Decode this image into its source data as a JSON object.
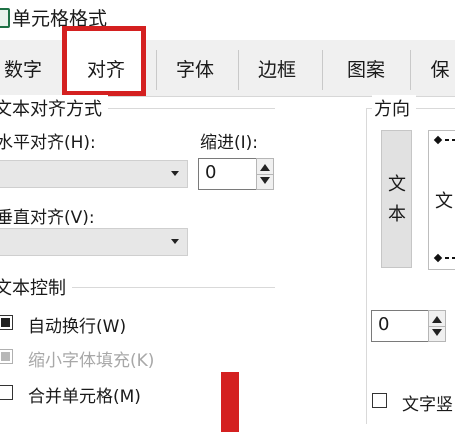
{
  "window": {
    "title": "单元格格式"
  },
  "tabs": [
    {
      "label": "数字"
    },
    {
      "label": "对齐"
    },
    {
      "label": "字体"
    },
    {
      "label": "边框"
    },
    {
      "label": "图案"
    },
    {
      "label": "保"
    }
  ],
  "alignment": {
    "group_title": "文本对齐方式",
    "horizontal_label": "水平对齐(H):",
    "horizontal_value": "",
    "indent_label": "缩进(I):",
    "indent_value": "0",
    "vertical_label": "垂直对齐(V):",
    "vertical_value": ""
  },
  "text_control": {
    "group_title": "文本控制",
    "wrap_label": "自动换行(W)",
    "wrap_checked": true,
    "shrink_label": "缩小字体填充(K)",
    "shrink_disabled": true,
    "merge_label": "合并单元格(M)",
    "merge_checked": false
  },
  "orientation": {
    "group_title": "方向",
    "vertical_text": [
      "文",
      "本"
    ],
    "preview_text": "文",
    "degrees_value": "0",
    "text_direction_label": "文字竖"
  },
  "annotation_color": "#d42020"
}
